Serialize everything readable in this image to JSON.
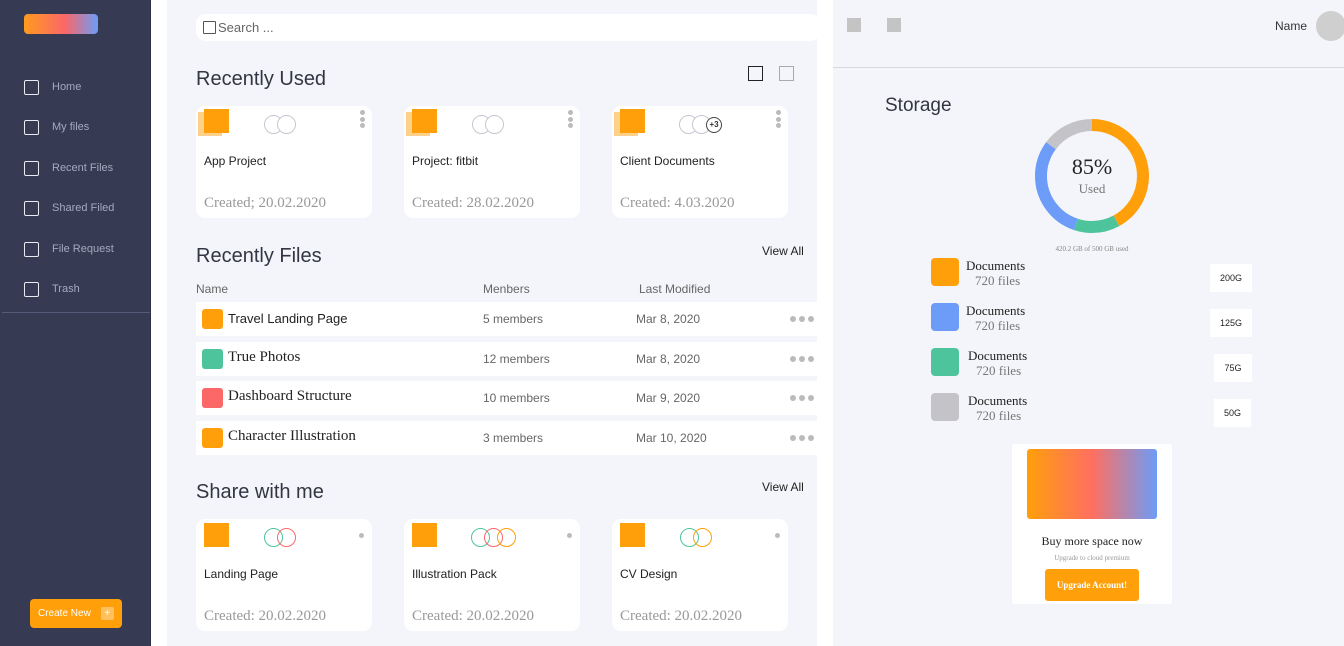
{
  "sidebar": {
    "items": [
      {
        "label": "Home"
      },
      {
        "label": "My files"
      },
      {
        "label": "Recent Files"
      },
      {
        "label": "Shared Filed"
      },
      {
        "label": "File Request"
      },
      {
        "label": "Trash"
      }
    ],
    "create_label": "Create New",
    "create_icon": "+"
  },
  "search": {
    "placeholder": "Search ..."
  },
  "recently_used": {
    "title": "Recently Used",
    "cards": [
      {
        "name": "App Project",
        "date": "Created; 20.02.2020"
      },
      {
        "name": "Project: fitbit",
        "date": "Created: 28.02.2020"
      },
      {
        "name": "Client Documents",
        "date": "Created: 4.03.2020",
        "more_members": "+3"
      }
    ]
  },
  "recent_files": {
    "title": "Recently Files",
    "view_all": "View All",
    "columns": {
      "name": "Name",
      "members": "Menbers",
      "modified": "Last Modified"
    },
    "rows": [
      {
        "name": "Travel Landing Page",
        "members": "5 members",
        "date": "Mar 8, 2020",
        "color": "#ff9f0a"
      },
      {
        "name": "True Photos",
        "members": "12 members",
        "date": "Mar 8, 2020",
        "color": "#4dc49c"
      },
      {
        "name": "Dashboard Structure",
        "members": "10 members",
        "date": "Mar 9, 2020",
        "color": "#fc6767"
      },
      {
        "name": "Character Illustration",
        "members": "3 members",
        "date": "Mar 10, 2020",
        "color": "#ff9f0a"
      }
    ]
  },
  "share_with_me": {
    "title": "Share with me",
    "view_all": "View All",
    "cards": [
      {
        "name": "Landing Page",
        "date": "Created: 20.02.2020"
      },
      {
        "name": "Illustration Pack",
        "date": "Created: 20.02.2020"
      },
      {
        "name": "CV Design",
        "date": "Created: 20.02.2020"
      }
    ]
  },
  "header": {
    "user_name": "Name"
  },
  "storage": {
    "title": "Storage",
    "percent_label": "85%",
    "used_label": "Used",
    "used_fraction": 0.85,
    "usage_note": "420.2 GB of 500 GB used",
    "segments": [
      {
        "color": "#ff9f0a",
        "value": 0.42
      },
      {
        "color": "#4dc49c",
        "value": 0.13
      },
      {
        "color": "#6c9cf7",
        "value": 0.3
      },
      {
        "color": "#c4c4c8",
        "value": 0.15
      }
    ],
    "categories": [
      {
        "name": "Documents",
        "count": "720 files",
        "size": "200G",
        "color": "#ff9f0a"
      },
      {
        "name": "Documents",
        "count": "720 files",
        "size": "125G",
        "color": "#6c9cf7"
      },
      {
        "name": "Documents",
        "count": "720 files",
        "size": "75G",
        "color": "#4dc49c"
      },
      {
        "name": "Documents",
        "count": "720 files",
        "size": "50G",
        "color": "#c4c4c8"
      }
    ]
  },
  "promo": {
    "title": "Buy more space now",
    "subtitle": "Upgrade to cloud premium",
    "button": "Upgrade Account!"
  },
  "colors": {
    "sidebar_bg": "#363a52",
    "accent": "#ff9f0a",
    "panel_bg": "#f4f5fa"
  }
}
